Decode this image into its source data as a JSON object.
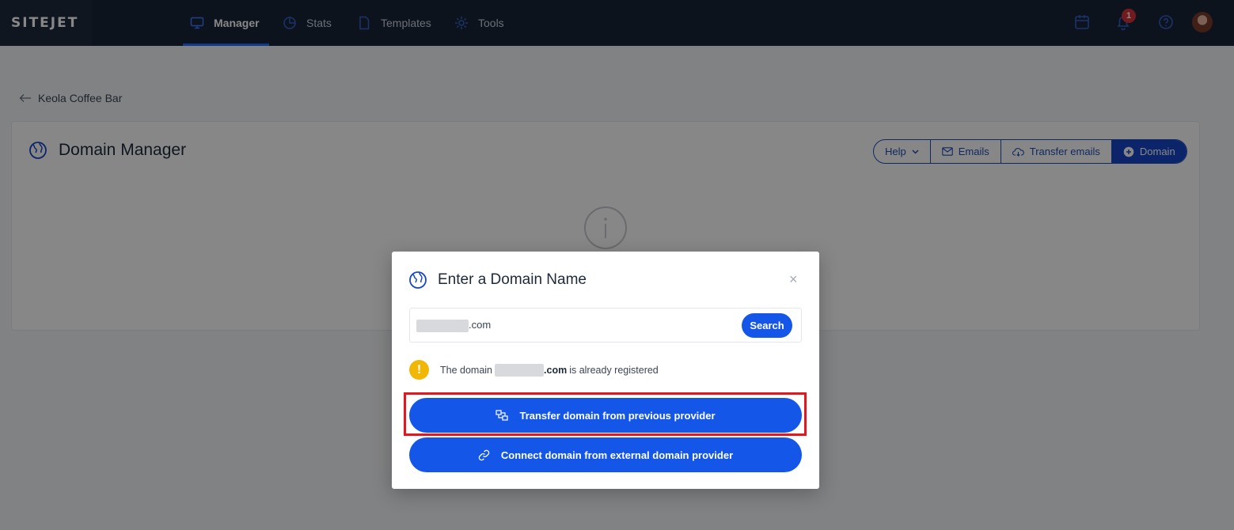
{
  "brand": {
    "logo": "SITEJET",
    "accent": "#1356e8",
    "topbar_bg": "#1a2536"
  },
  "nav": {
    "items": [
      {
        "label": "Manager",
        "icon": "monitor-icon",
        "active": true
      },
      {
        "label": "Stats",
        "icon": "pie-chart-icon",
        "active": false
      },
      {
        "label": "Templates",
        "icon": "file-icon",
        "active": false
      },
      {
        "label": "Tools",
        "icon": "tools-icon",
        "active": false
      }
    ],
    "right_icons": [
      "calendar-icon",
      "bell-icon",
      "help-circle-icon",
      "avatar"
    ],
    "notification_count": "1"
  },
  "breadcrumb": {
    "back_label": "Keola Coffee Bar"
  },
  "page": {
    "title": "Domain Manager",
    "actions": [
      {
        "label": "Help",
        "icon": "chevron-down-icon"
      },
      {
        "label": "Emails",
        "icon": "mail-icon"
      },
      {
        "label": "Transfer emails",
        "icon": "cloud-transfer-icon"
      },
      {
        "label": "Domain",
        "icon": "plus-circle-icon"
      }
    ]
  },
  "modal": {
    "title": "Enter a Domain Name",
    "search_value": ".com",
    "search_button": "Search",
    "warning": {
      "prefix": "The domain",
      "domain_suffix": ".com",
      "suffix": "is already registered"
    },
    "transfer_button": "Transfer domain from previous provider",
    "connect_button": "Connect domain from external domain provider",
    "highlight_color": "#e0181f"
  }
}
